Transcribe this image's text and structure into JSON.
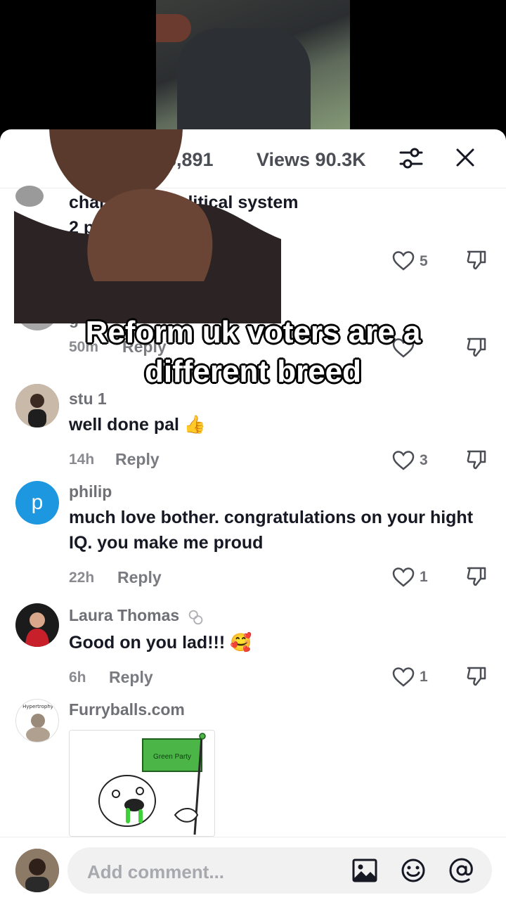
{
  "header": {
    "likes_label": "6,891",
    "views_label": "Views 90.3K"
  },
  "caption": {
    "line1": "Reform uk voters are a",
    "line2": "different breed"
  },
  "comments": [
    {
      "text": "change the political system\n2 party system.",
      "likes": "5"
    },
    {
      "username": "g",
      "time": "50m",
      "reply": "Reply"
    },
    {
      "username": "stu 1",
      "text": "well done pal 👍",
      "time": "14h",
      "reply": "Reply",
      "likes": "3"
    },
    {
      "username": "philip",
      "avatar_letter": "p",
      "text": "much love bother. congratulations on your hight IQ. you make me proud",
      "time": "22h",
      "reply": "Reply",
      "likes": "1"
    },
    {
      "username": "Laura Thomas",
      "text": "Good on you lad!!! 🥰",
      "time": "6h",
      "reply": "Reply",
      "likes": "1"
    },
    {
      "username": "Furryballs.com",
      "avatar_text": "Hypertrophy",
      "gif_flag_text": "Green Party"
    }
  ],
  "composer": {
    "placeholder": "Add comment..."
  },
  "icons": {
    "filter": "filter-icon",
    "close": "close-icon",
    "like": "heart-icon",
    "dislike": "dislike-icon",
    "image": "image-icon",
    "emoji": "emoji-icon",
    "mention": "at-icon"
  },
  "colors": {
    "accent_avatar": "#1c97e0",
    "text_primary": "#161823",
    "text_secondary": "#6f7075"
  }
}
